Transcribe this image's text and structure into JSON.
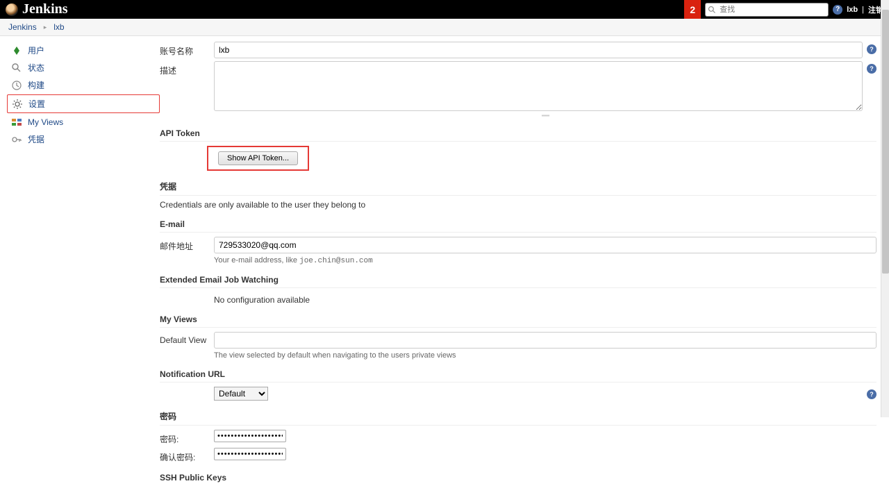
{
  "header": {
    "brand": "Jenkins",
    "notif_count": "2",
    "search_placeholder": "查找",
    "user_link": "lxb",
    "logout_link": "注销"
  },
  "breadcrumb": {
    "items": [
      "Jenkins",
      "lxb"
    ]
  },
  "sidebar": {
    "items": [
      {
        "label": "用户"
      },
      {
        "label": "状态"
      },
      {
        "label": "构建"
      },
      {
        "label": "设置"
      },
      {
        "label": "My Views"
      },
      {
        "label": "凭据"
      }
    ]
  },
  "form": {
    "account_name_label": "账号名称",
    "account_name_value": "lxb",
    "desc_label": "描述",
    "desc_value": "",
    "api_token_title": "API Token",
    "show_api_token_btn": "Show API Token...",
    "creds_title": "凭据",
    "creds_text": "Credentials are only available to the user they belong to",
    "email_title": "E-mail",
    "email_label": "邮件地址",
    "email_value": "729533020@qq.com",
    "email_hint_pre": "Your e-mail address, like ",
    "email_hint_code": "joe.chin@sun.com",
    "ext_email_title": "Extended Email Job Watching",
    "ext_email_text": "No configuration available",
    "myviews_title": "My Views",
    "default_view_label": "Default View",
    "default_view_value": "",
    "default_view_hint": "The view selected by default when navigating to the users private views",
    "notif_url_title": "Notification URL",
    "notif_url_option": "Default",
    "password_title": "密码",
    "password_label": "密码:",
    "password_confirm_label": "确认密码:",
    "password_mask": "••••••••••••••••••••••••",
    "ssh_title": "SSH Public Keys"
  }
}
